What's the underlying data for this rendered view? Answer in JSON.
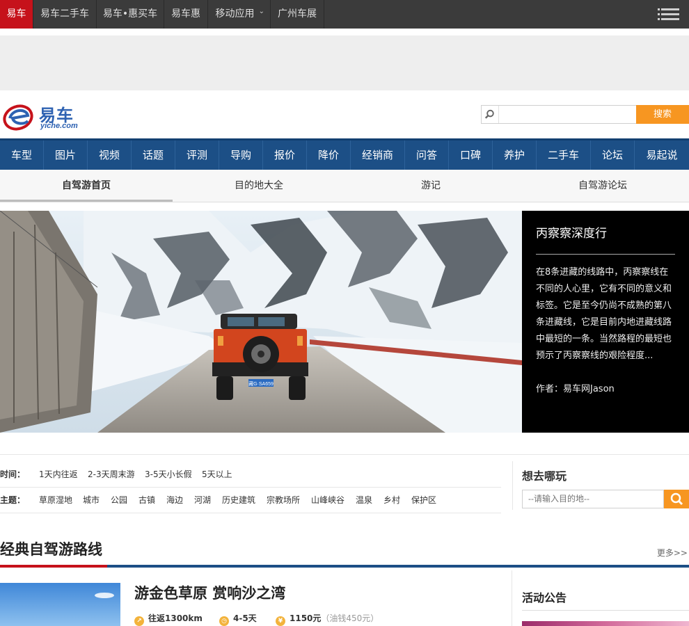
{
  "topbar": {
    "items": [
      "易车",
      "易车二手车",
      "易车•惠买车",
      "易车惠",
      "移动应用",
      "广州车展"
    ]
  },
  "logo": {
    "cn": "易车",
    "en": "yiche.com"
  },
  "search": {
    "placeholder": "",
    "button": "搜索"
  },
  "mainnav": [
    "车型",
    "图片",
    "视频",
    "话题",
    "评测",
    "导购",
    "报价",
    "降价",
    "经销商",
    "问答",
    "口碑",
    "养护",
    "二手车",
    "论坛",
    "易起说"
  ],
  "subnav": [
    "自驾游首页",
    "目的地大全",
    "游记",
    "自驾游论坛"
  ],
  "hero": {
    "title": "丙察察深度行",
    "desc": "在8条进藏的线路中，丙察察线在不同的人心里，它有不同的意义和标签。它是至今仍尚不成熟的第八条进藏线，它是目前内地进藏线路中最短的一条。当然路程的最短也预示了丙察察线的艰险程度...",
    "author": "作者：易车网Jason",
    "plate": "藏G·SA659"
  },
  "filters": {
    "time_label": "时间：",
    "time_options": [
      "1天内往返",
      "2-3天周末游",
      "3-5天小长假",
      "5天以上"
    ],
    "theme_label": "主题：",
    "theme_options": [
      "草原湿地",
      "城市",
      "公园",
      "古镇",
      "海边",
      "河湖",
      "历史建筑",
      "宗教场所",
      "山峰峡谷",
      "温泉",
      "乡村",
      "保护区"
    ]
  },
  "goplay": {
    "title": "想去哪玩",
    "placeholder": "--请输入目的地--"
  },
  "routes": {
    "title": "经典自驾游路线",
    "more": "更多>>",
    "item": {
      "title": "游金色草原 赏响沙之湾",
      "distance": "往返1300km",
      "days": "4-5天",
      "cost": "1150元",
      "cost_note": "（油钱450元）"
    }
  },
  "notice": {
    "title": "活动公告"
  },
  "colors": {
    "brand_red": "#c6121b",
    "nav_blue": "#1c4f86",
    "accent_orange": "#f79621"
  }
}
